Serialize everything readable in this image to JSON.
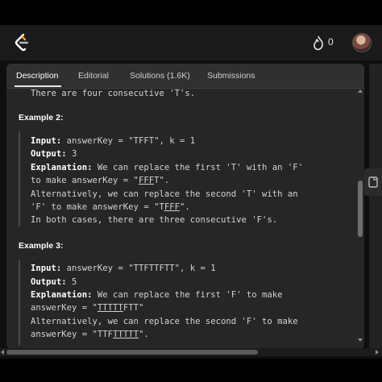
{
  "header": {
    "streak_count": "0"
  },
  "tabs": [
    {
      "label": "Description",
      "active": true
    },
    {
      "label": "Editorial"
    },
    {
      "label": "Solutions (1.6K)"
    },
    {
      "label": "Submissions"
    }
  ],
  "content": {
    "prev_line": "There are four consecutive 'T's.",
    "example2": {
      "title": "Example 2:",
      "input_label": "Input:",
      "input_value": " answerKey = \"TFFT\", k = 1",
      "output_label": "Output:",
      "output_value": " 3",
      "explanation_label": "Explanation:",
      "explanation_rest": " We can replace the first 'T' with an 'F'",
      "line2_pre": "to make answerKey = \"",
      "line2_u": "FFF",
      "line2_post": "T\".",
      "line3": "Alternatively, we can replace the second 'T' with an",
      "line4_pre": "'F' to make answerKey = \"T",
      "line4_u": "FFF",
      "line4_post": "\".",
      "line5": "In both cases, there are three consecutive 'F's."
    },
    "example3": {
      "title": "Example 3:",
      "input_label": "Input:",
      "input_value": " answerKey = \"TTFTTFTT\", k = 1",
      "output_label": "Output:",
      "output_value": " 5",
      "explanation_label": "Explanation:",
      "explanation_rest": " We can replace the first 'F' to make",
      "line2_pre": "answerKey = \"",
      "line2_u": "TTTTT",
      "line2_post": "FTT\"",
      "line3": "Alternatively, we can replace the second 'F' to make",
      "line4_pre": "answerKey = \"TTF",
      "line4_u": "TTTTT",
      "line4_post": "\"."
    }
  },
  "colors": {
    "background": "#0f0f0f",
    "panel": "#262626",
    "accent_logo": "#ffa116"
  }
}
